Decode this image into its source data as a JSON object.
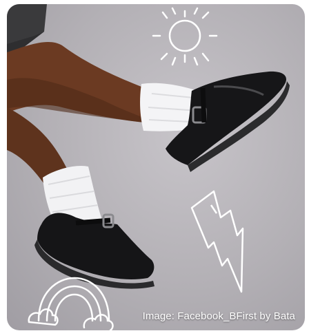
{
  "image": {
    "caption": "Image: Facebook_BFirst by Bata",
    "doodles": [
      "sun-doodle",
      "lightning-bolt-doodle",
      "rainbow-doodle"
    ]
  }
}
